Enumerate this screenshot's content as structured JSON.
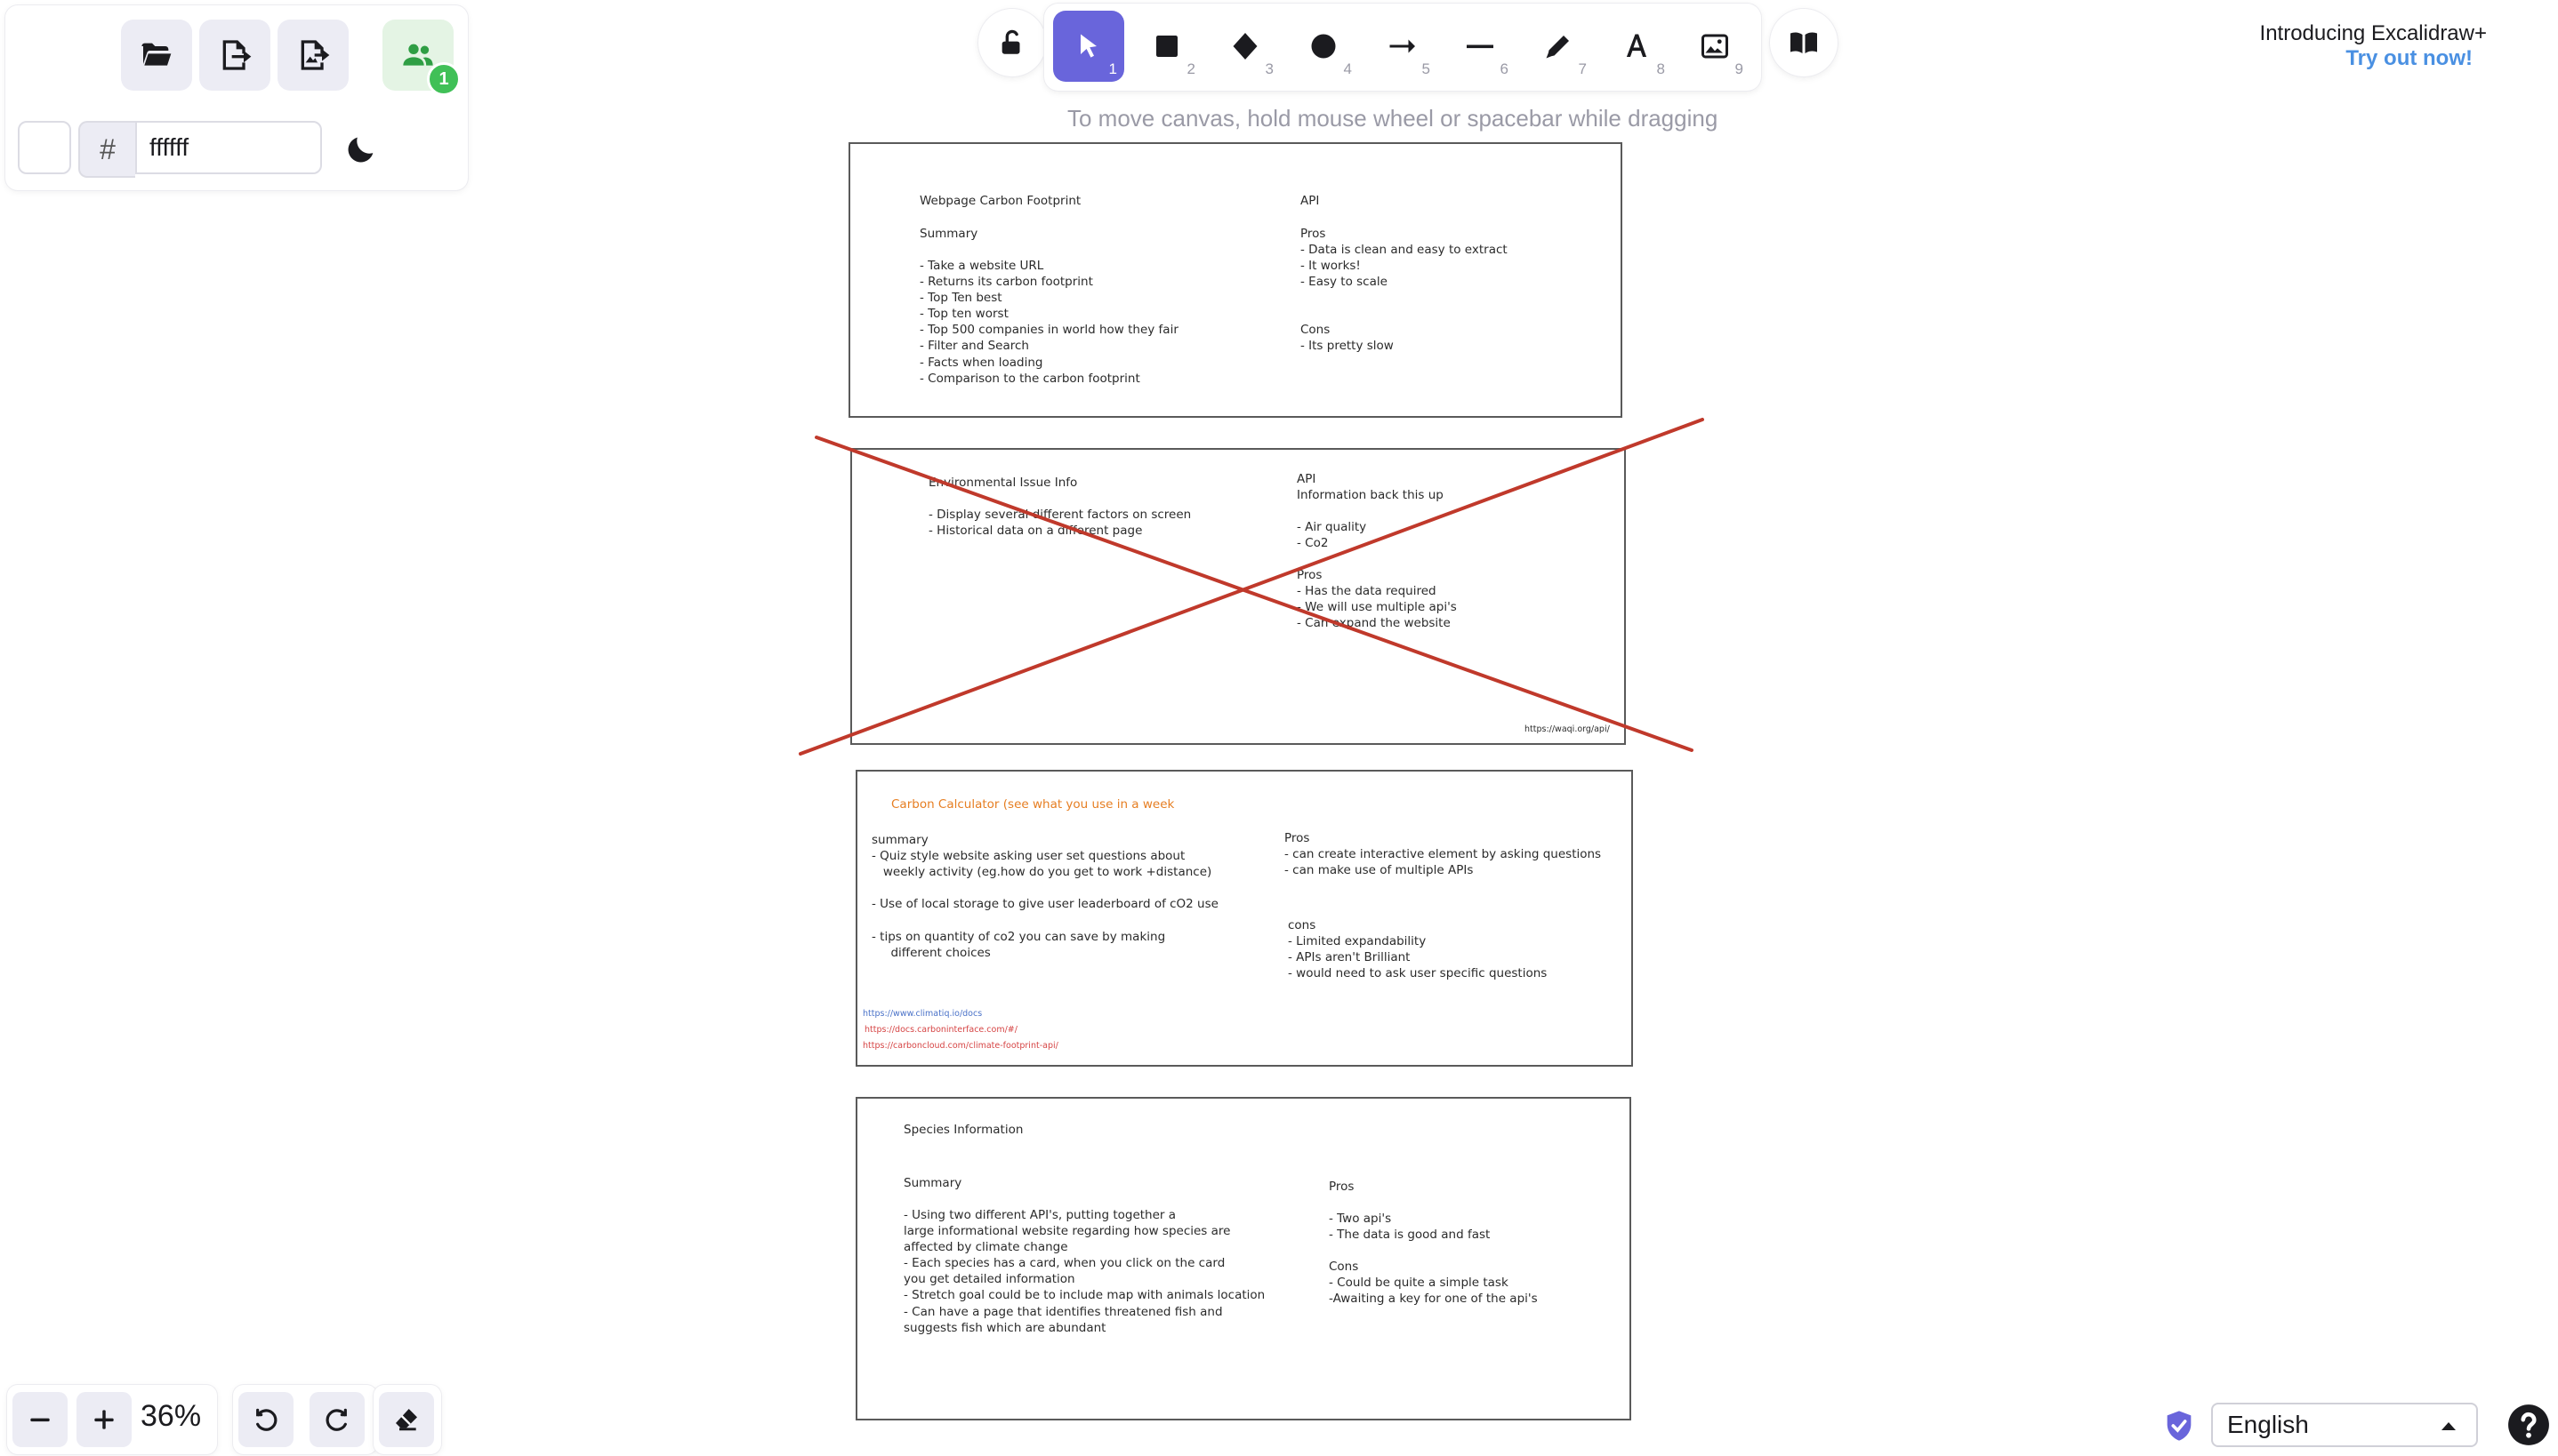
{
  "left_panel": {
    "canvas_bg_hex": "ffffff",
    "collab_count": "1",
    "hash": "#"
  },
  "toolbar": {
    "tools": [
      {
        "name": "selection",
        "key": "1"
      },
      {
        "name": "rectangle",
        "key": "2"
      },
      {
        "name": "diamond",
        "key": "3"
      },
      {
        "name": "ellipse",
        "key": "4"
      },
      {
        "name": "arrow",
        "key": "5"
      },
      {
        "name": "line",
        "key": "6"
      },
      {
        "name": "draw",
        "key": "7"
      },
      {
        "name": "text",
        "key": "8"
      },
      {
        "name": "image",
        "key": "9"
      }
    ],
    "active_tool": "selection"
  },
  "hint": "To move canvas, hold mouse wheel or spacebar while dragging",
  "promo": {
    "title": "Introducing Excalidraw+",
    "link": "Try out now!"
  },
  "cards": {
    "card1": {
      "title": "Webpage Carbon Footprint",
      "summary_label": "Summary",
      "summary_lines": "- Take a website URL\n- Returns its carbon footprint\n- Top Ten best\n- Top ten worst\n- Top 500 companies in world how they fair\n- Filter and Search\n- Facts when loading\n- Comparison to the carbon footprint",
      "api_label": "API",
      "pros": "Pros\n- Data is clean and easy to extract\n- It works!\n- Easy to scale",
      "cons": "Cons\n- Its pretty slow"
    },
    "card2": {
      "title": "Environmental Issue Info",
      "summary_lines": "- Display several different factors on screen\n- Historical data on a different page",
      "api": "API\nInformation back this up",
      "api_items": "- Air quality\n- Co2",
      "pros": "Pros\n- Has the data required\n- We will use multiple api's\n- Can expand the website",
      "url": "https://waqi.org/api/"
    },
    "card3": {
      "title": "Carbon Calculator (see what you use in a week",
      "summary": "summary\n- Quiz style website asking user set questions about\n   weekly activity (eg.how do you get to work +distance)\n\n- Use of local storage to give user leaderboard of cO2 use\n\n- tips on quantity of co2 you can save by making\n     different choices",
      "pros": "Pros\n- can create interactive element by asking questions\n- can make use of multiple APIs",
      "cons": "cons\n- Limited expandability\n- APIs aren't Brilliant\n- would need to ask user specific questions",
      "link1": "https://www.climatiq.io/docs",
      "link2": "https://docs.carboninterface.com/#/",
      "link3": "https://carboncloud.com/climate-footprint-api/"
    },
    "card4": {
      "title": "Species Information",
      "summary_label": "Summary",
      "summary_lines": "- Using two different API's, putting together a\nlarge informational website regarding how species are\naffected by climate change\n- Each species has a card, when you click on the card\nyou get detailed information\n- Stretch goal could be to include map with animals location\n- Can have a page that identifies threatened fish and\nsuggests fish which are abundant",
      "pros": "Pros\n\n- Two api's\n- The data is good and fast",
      "cons": "Cons\n- Could be quite a simple task\n-Awaiting a key for one of the api's"
    }
  },
  "bottom": {
    "zoom": "36%",
    "language": "English"
  },
  "colors": {
    "accent": "#6965db",
    "collab_green": "#40c057",
    "cross_red": "#c0392b",
    "link_blue": "#4a90e2"
  }
}
